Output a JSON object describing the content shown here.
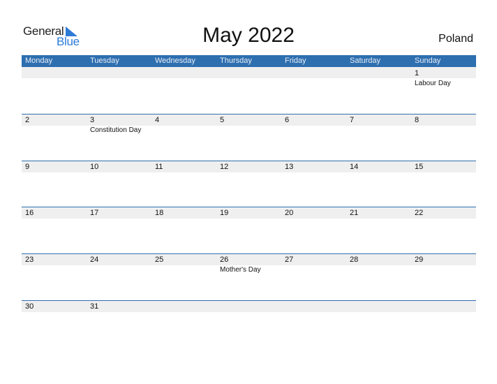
{
  "logo": {
    "word1": "General",
    "word2": "Blue",
    "icon": "triangle-flag-icon",
    "accent": "#2e7bd6"
  },
  "title": "May 2022",
  "country": "Poland",
  "colors": {
    "header_bg": "#2e6fb0",
    "band_bg": "#efefef"
  },
  "weekdays": [
    "Monday",
    "Tuesday",
    "Wednesday",
    "Thursday",
    "Friday",
    "Saturday",
    "Sunday"
  ],
  "weeks": [
    [
      {
        "d": ""
      },
      {
        "d": ""
      },
      {
        "d": ""
      },
      {
        "d": ""
      },
      {
        "d": ""
      },
      {
        "d": ""
      },
      {
        "d": "1",
        "h": "Labour Day"
      }
    ],
    [
      {
        "d": "2"
      },
      {
        "d": "3",
        "h": "Constitution Day"
      },
      {
        "d": "4"
      },
      {
        "d": "5"
      },
      {
        "d": "6"
      },
      {
        "d": "7"
      },
      {
        "d": "8"
      }
    ],
    [
      {
        "d": "9"
      },
      {
        "d": "10"
      },
      {
        "d": "11"
      },
      {
        "d": "12"
      },
      {
        "d": "13"
      },
      {
        "d": "14"
      },
      {
        "d": "15"
      }
    ],
    [
      {
        "d": "16"
      },
      {
        "d": "17"
      },
      {
        "d": "18"
      },
      {
        "d": "19"
      },
      {
        "d": "20"
      },
      {
        "d": "21"
      },
      {
        "d": "22"
      }
    ],
    [
      {
        "d": "23"
      },
      {
        "d": "24"
      },
      {
        "d": "25"
      },
      {
        "d": "26",
        "h": "Mother's Day"
      },
      {
        "d": "27"
      },
      {
        "d": "28"
      },
      {
        "d": "29"
      }
    ],
    [
      {
        "d": "30"
      },
      {
        "d": "31"
      },
      {
        "d": ""
      },
      {
        "d": ""
      },
      {
        "d": ""
      },
      {
        "d": ""
      },
      {
        "d": ""
      }
    ]
  ]
}
